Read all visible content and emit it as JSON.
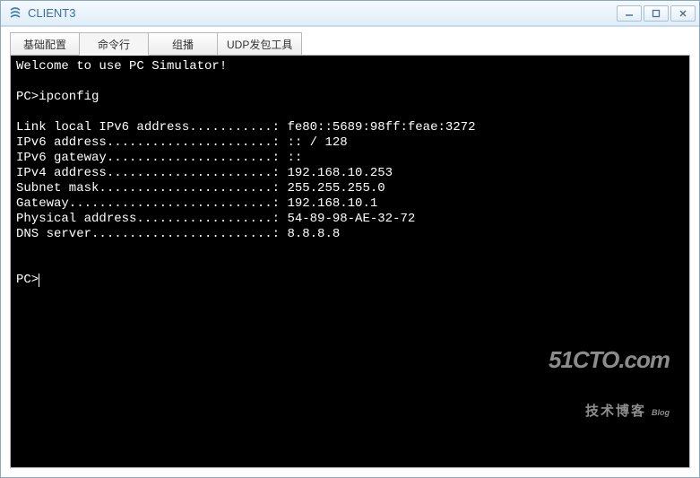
{
  "window": {
    "title": "CLIENT3"
  },
  "tabs": [
    {
      "label": "基础配置"
    },
    {
      "label": "命令行"
    },
    {
      "label": "组播"
    },
    {
      "label": "UDP发包工具"
    }
  ],
  "terminal": {
    "welcome": "Welcome to use PC Simulator!",
    "prompt1": "PC>ipconfig",
    "lines": [
      "Link local IPv6 address...........: fe80::5689:98ff:feae:3272",
      "IPv6 address......................: :: / 128",
      "IPv6 gateway......................: ::",
      "IPv4 address......................: 192.168.10.253",
      "Subnet mask.......................: 255.255.255.0",
      "Gateway...........................: 192.168.10.1",
      "Physical address..................: 54-89-98-AE-32-72",
      "DNS server........................: 8.8.8.8"
    ],
    "prompt2": "PC>"
  },
  "watermark": {
    "line1": "51CTO.com",
    "line2": "技术博客",
    "line2b": "Blog"
  }
}
